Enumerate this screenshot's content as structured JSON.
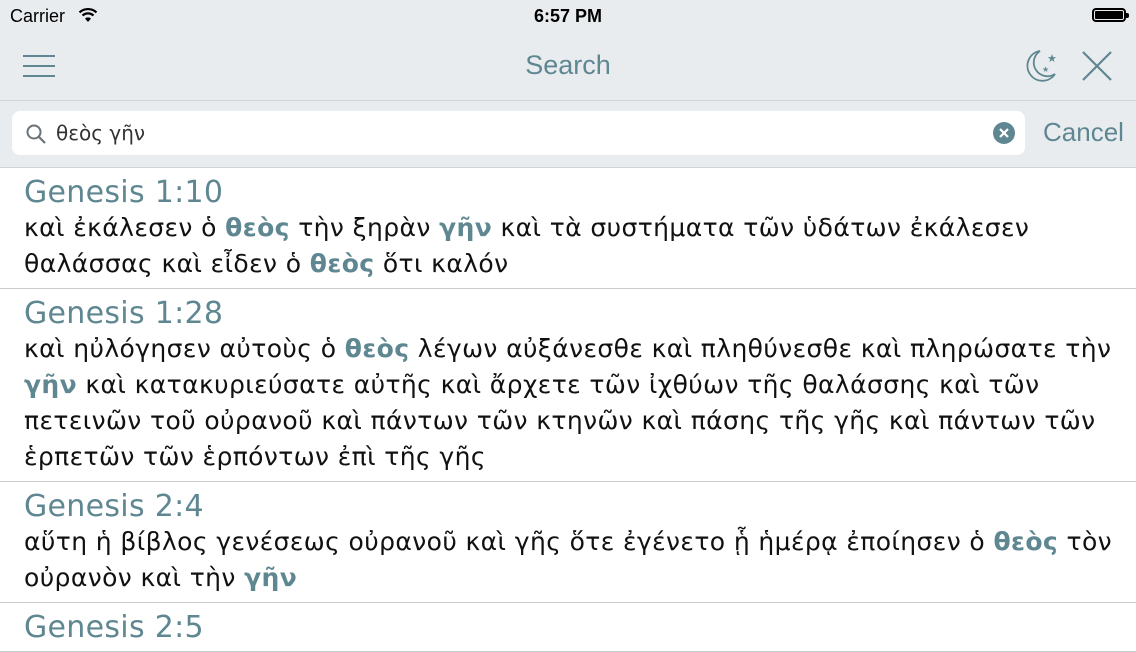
{
  "status_bar": {
    "carrier": "Carrier",
    "time": "6:57 PM",
    "battery_level": 1.0
  },
  "nav": {
    "title": "Search",
    "left_icon": "hamburger-menu-icon",
    "right_icons": [
      "night-mode-icon",
      "close-icon"
    ]
  },
  "search": {
    "query": "θεὸς γῆν",
    "cancel_label": "Cancel"
  },
  "colors": {
    "accent": "#5f8791",
    "bar_background": "#e9ecef",
    "separator": "#c8cdd1"
  },
  "results": [
    {
      "reference": "Genesis 1:10",
      "segments": [
        {
          "text": "καὶ ἐκάλεσεν ὁ ",
          "hl": false
        },
        {
          "text": "θεὸς",
          "hl": true
        },
        {
          "text": " τὴν ξηρὰν ",
          "hl": false
        },
        {
          "text": "γῆν",
          "hl": true
        },
        {
          "text": " καὶ τὰ συστήματα τῶν ὑδάτων ἐκάλεσεν θαλάσσας καὶ εἶδεν ὁ ",
          "hl": false
        },
        {
          "text": "θεὸς",
          "hl": true
        },
        {
          "text": " ὅτι καλόν",
          "hl": false
        }
      ]
    },
    {
      "reference": "Genesis 1:28",
      "segments": [
        {
          "text": "καὶ ηὐλόγησεν αὐτοὺς ὁ ",
          "hl": false
        },
        {
          "text": "θεὸς",
          "hl": true
        },
        {
          "text": " λέγων αὐξάνεσθε καὶ πληθύνεσθε καὶ πληρώσατε τὴν ",
          "hl": false
        },
        {
          "text": "γῆν",
          "hl": true
        },
        {
          "text": " καὶ κατακυριεύσατε αὐτῆς καὶ ἄρχετε τῶν ἰχθύων τῆς θαλάσσης καὶ τῶν πετεινῶν τοῦ οὐρανοῦ καὶ πάντων τῶν κτηνῶν καὶ πάσης τῆς γῆς καὶ πάντων τῶν ἑρπετῶν τῶν ἑρπόντων ἐπὶ τῆς γῆς",
          "hl": false
        }
      ]
    },
    {
      "reference": "Genesis 2:4",
      "segments": [
        {
          "text": "αὕτη ἡ βίβλος γενέσεως οὐρανοῦ καὶ γῆς ὅτε ἐγένετο ᾗ ἡμέρᾳ ἐποίησεν ὁ ",
          "hl": false
        },
        {
          "text": "θεὸς",
          "hl": true
        },
        {
          "text": " τὸν οὐρανὸν καὶ τὴν ",
          "hl": false
        },
        {
          "text": "γῆν",
          "hl": true
        }
      ]
    },
    {
      "reference": "Genesis 2:5",
      "segments": []
    }
  ]
}
